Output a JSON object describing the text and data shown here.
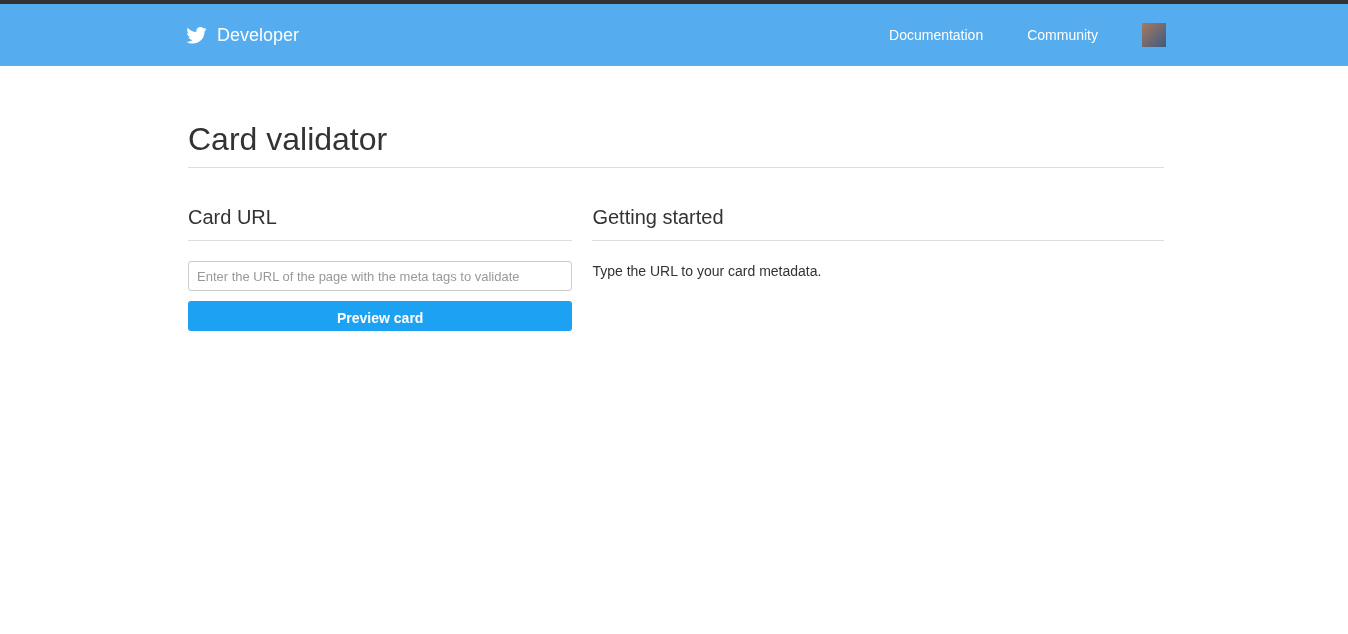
{
  "header": {
    "brand": "Developer",
    "nav": [
      "Documentation",
      "Community"
    ]
  },
  "page": {
    "title": "Card validator"
  },
  "left": {
    "heading": "Card URL",
    "url_field": {
      "placeholder": "Enter the URL of the page with the meta tags to validate"
    },
    "button": "Preview card"
  },
  "right": {
    "heading": "Getting started",
    "text": "Type the URL to your card metadata."
  }
}
